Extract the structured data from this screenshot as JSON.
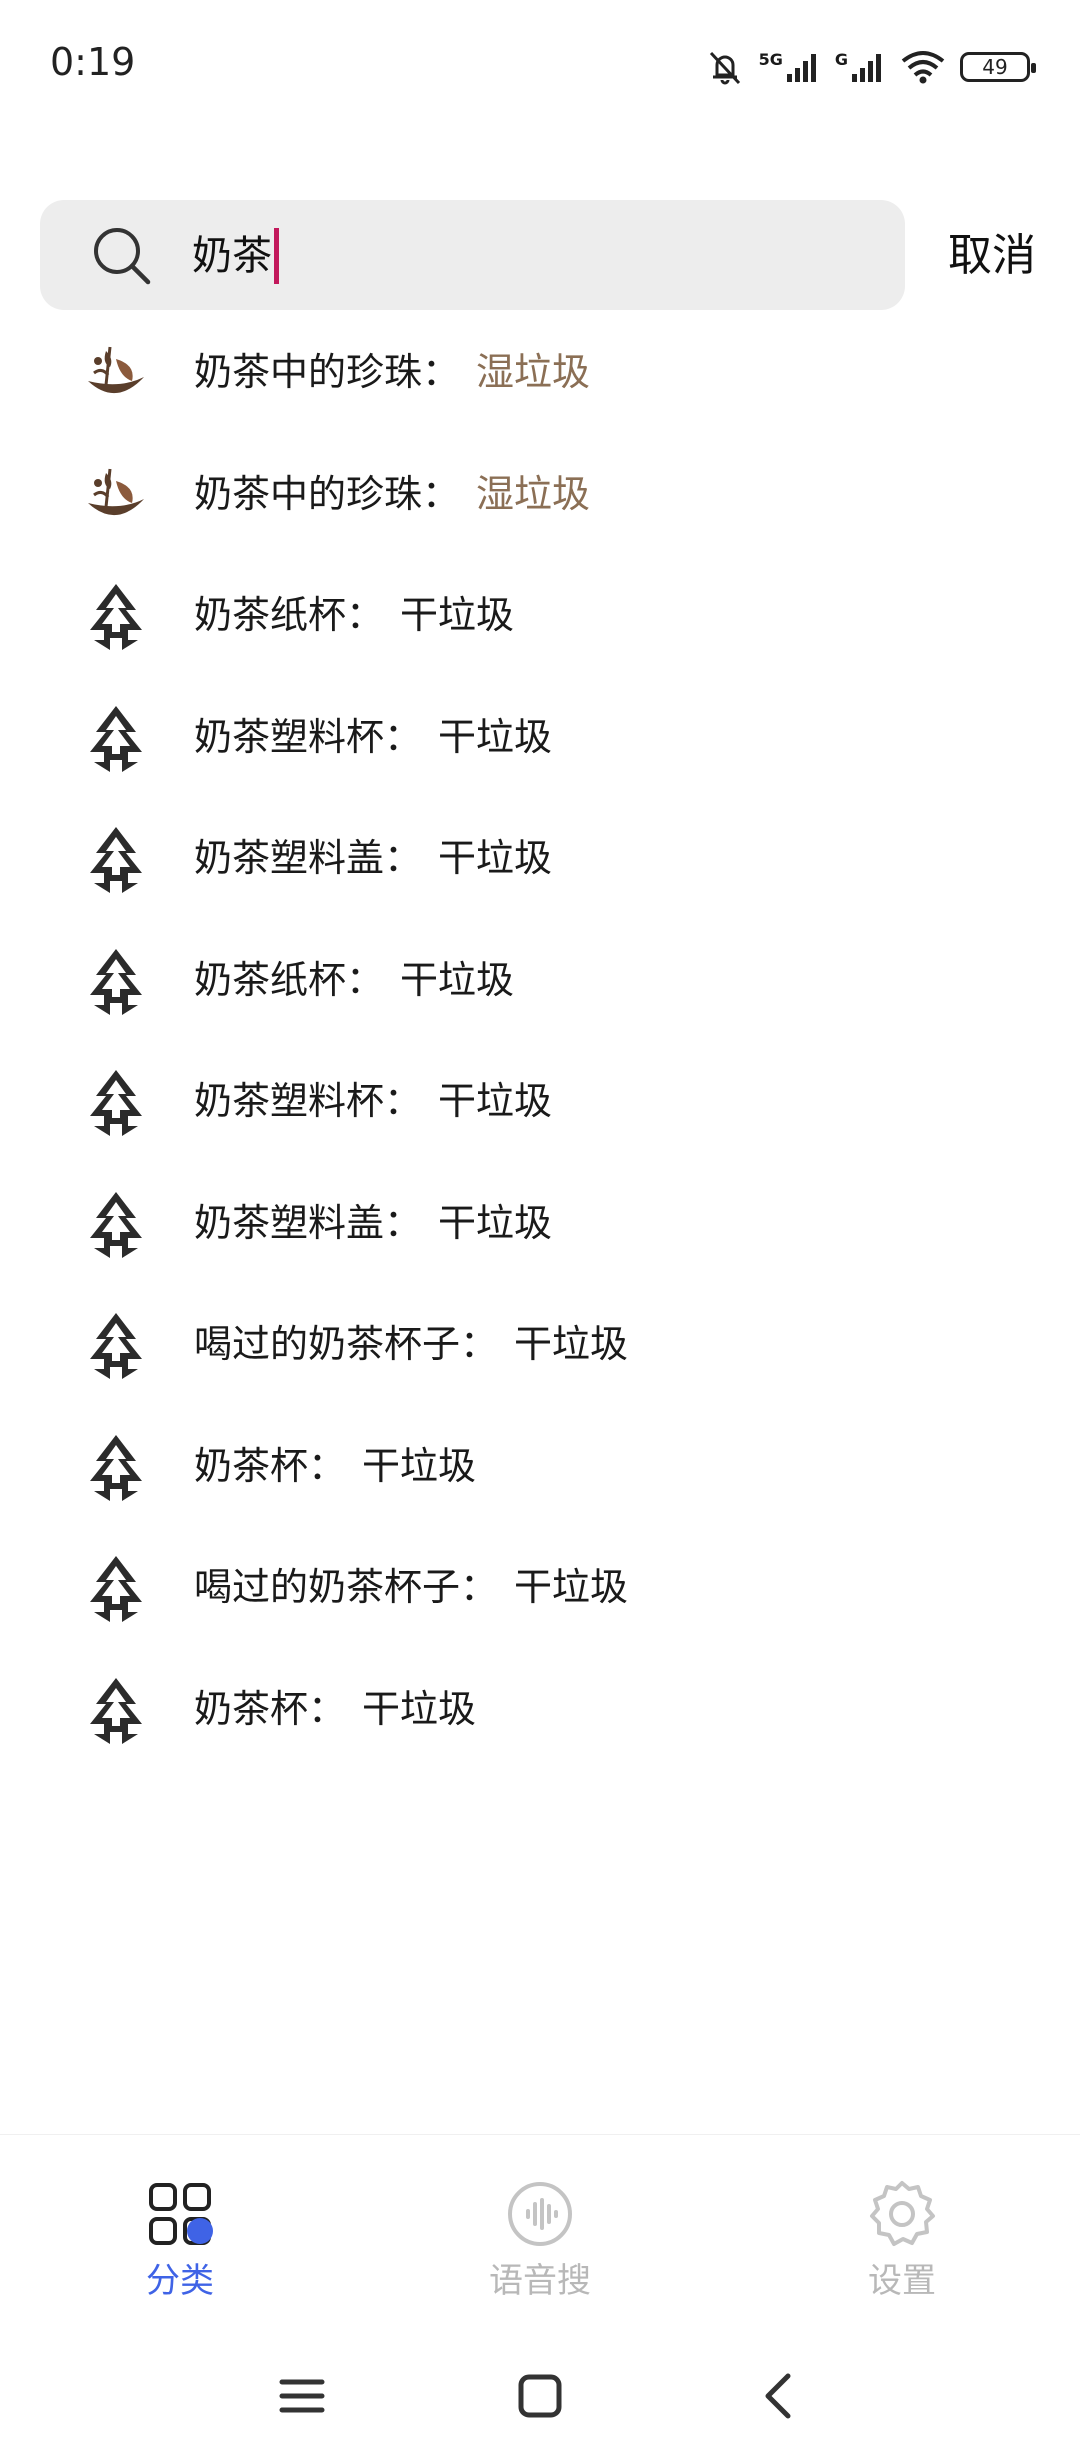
{
  "status_bar": {
    "time": "0:19",
    "network_label_1": "5G",
    "network_label_2": "G",
    "battery": "49",
    "icons": [
      "bell-muted-icon",
      "signal-icon",
      "signal-icon",
      "wifi-icon",
      "battery-icon"
    ]
  },
  "search": {
    "value": "奶茶",
    "cancel_label": "取消"
  },
  "colors": {
    "wet_accent": "#8b6f55",
    "active_tab": "#3f63e6",
    "caret": "#c2185b"
  },
  "results": [
    {
      "name": "奶茶中的珍珠",
      "category": "湿垃圾",
      "icon": "wet-waste-icon"
    },
    {
      "name": "奶茶中的珍珠",
      "category": "湿垃圾",
      "icon": "wet-waste-icon"
    },
    {
      "name": "奶茶纸杯",
      "category": "干垃圾",
      "icon": "dry-waste-icon"
    },
    {
      "name": "奶茶塑料杯",
      "category": "干垃圾",
      "icon": "dry-waste-icon"
    },
    {
      "name": "奶茶塑料盖",
      "category": "干垃圾",
      "icon": "dry-waste-icon"
    },
    {
      "name": "奶茶纸杯",
      "category": "干垃圾",
      "icon": "dry-waste-icon"
    },
    {
      "name": "奶茶塑料杯",
      "category": "干垃圾",
      "icon": "dry-waste-icon"
    },
    {
      "name": "奶茶塑料盖",
      "category": "干垃圾",
      "icon": "dry-waste-icon"
    },
    {
      "name": "喝过的奶茶杯子",
      "category": "干垃圾",
      "icon": "dry-waste-icon"
    },
    {
      "name": "奶茶杯",
      "category": "干垃圾",
      "icon": "dry-waste-icon"
    },
    {
      "name": "喝过的奶茶杯子",
      "category": "干垃圾",
      "icon": "dry-waste-icon"
    },
    {
      "name": "奶茶杯",
      "category": "干垃圾",
      "icon": "dry-waste-icon"
    }
  ],
  "separator": "：",
  "bottom_nav": {
    "tabs": [
      {
        "label": "分类",
        "icon": "grid-icon",
        "active": true
      },
      {
        "label": "语音搜",
        "icon": "voice-icon",
        "active": false
      },
      {
        "label": "设置",
        "icon": "gear-icon",
        "active": false
      }
    ]
  },
  "system_nav": [
    "menu-icon",
    "home-icon",
    "back-icon"
  ]
}
